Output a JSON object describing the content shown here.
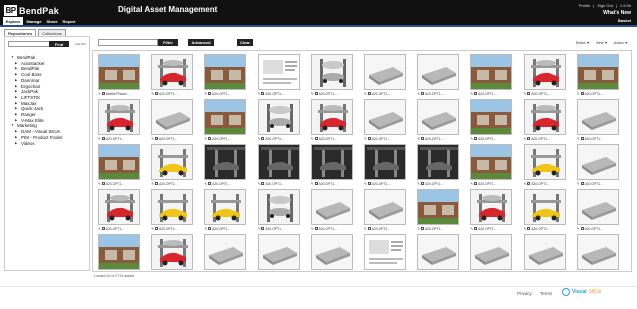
{
  "header": {
    "logo_mark": "BP",
    "logo_text": "BendPak",
    "title": "Digital Asset Management",
    "links": [
      "Profile",
      "Sign Out",
      "1.9.9h"
    ],
    "whats_new": "What's New",
    "basket": "Basket"
  },
  "nav": {
    "tabs": [
      "Explore",
      "Manage",
      "Share",
      "Report"
    ],
    "active": "Explore"
  },
  "subtabs": [
    "Repositories",
    "Collections"
  ],
  "left_panel": {
    "search_placeholder": "",
    "find_label": "Find",
    "advanced_label": "Adv.Sch"
  },
  "tree": [
    {
      "label": "BendPak",
      "level": 0,
      "arrow": "▼"
    },
    {
      "label": "Autostacker",
      "level": 1,
      "arrow": "▶"
    },
    {
      "label": "BendPak",
      "level": 1,
      "arrow": "▶"
    },
    {
      "label": "Cool Boss",
      "level": 1,
      "arrow": "▶"
    },
    {
      "label": "Dannmar",
      "level": 1,
      "arrow": "▶"
    },
    {
      "label": "Ergochair",
      "level": 1,
      "arrow": "▶"
    },
    {
      "label": "JackPak",
      "level": 1,
      "arrow": "▶"
    },
    {
      "label": "LIFTSTIK",
      "level": 1,
      "arrow": "▶"
    },
    {
      "label": "MaxJax",
      "level": 1,
      "arrow": "▶"
    },
    {
      "label": "Quick-Jack",
      "level": 1,
      "arrow": "▶"
    },
    {
      "label": "Ranger",
      "level": 1,
      "arrow": "▶"
    },
    {
      "label": "V-Max Elite",
      "level": 1,
      "arrow": "▶"
    },
    {
      "label": "Marketing",
      "level": 0,
      "arrow": "▼"
    },
    {
      "label": "DAM - Visual SKUs",
      "level": 1,
      "arrow": "▶"
    },
    {
      "label": "PIM - Product Finder",
      "level": 1,
      "arrow": "▶"
    },
    {
      "label": "Videos",
      "level": 1,
      "arrow": "▶"
    }
  ],
  "toolbar": {
    "search_placeholder": "",
    "filter": "Filter",
    "advanced": "Advanced",
    "clear": "Clear",
    "right": [
      "Select ▼",
      "View ▼",
      "Action ▼"
    ]
  },
  "assets": [
    {
      "label": "Mobile Photos...",
      "kind": "garage"
    },
    {
      "label": "A20-OPT1...",
      "kind": "lift-red"
    },
    {
      "label": "A20-OPT1...",
      "kind": "garage"
    },
    {
      "label": "A20-OPT1-...",
      "kind": "doc"
    },
    {
      "label": "A20-OPT1-...",
      "kind": "lift-gray"
    },
    {
      "label": "A20-OPT1-...",
      "kind": "platform"
    },
    {
      "label": "A20-OPT1-...",
      "kind": "platform"
    },
    {
      "label": "A20-OPT1-...",
      "kind": "garage"
    },
    {
      "label": "A20-OPT1-...",
      "kind": "lift-red"
    },
    {
      "label": "A20-OPT1-...",
      "kind": "garage"
    },
    {
      "label": "A20-OPT1...",
      "kind": "lift-red"
    },
    {
      "label": "A20-OPT1...",
      "kind": "platform"
    },
    {
      "label": "A20-OPT1...",
      "kind": "garage"
    },
    {
      "label": "A20-OPT1...",
      "kind": "lift-gray"
    },
    {
      "label": "A20-OPT1...",
      "kind": "lift-red"
    },
    {
      "label": "A20-OPT1...",
      "kind": "platform"
    },
    {
      "label": "A20-OPT1...",
      "kind": "platform"
    },
    {
      "label": "A20-OPT1...",
      "kind": "garage"
    },
    {
      "label": "A20-OPT1...",
      "kind": "lift-red"
    },
    {
      "label": "A20-OPT1...",
      "kind": "platform"
    },
    {
      "label": "A20-OPT1...",
      "kind": "garage"
    },
    {
      "label": "A20-OPT1...",
      "kind": "lift-yellow"
    },
    {
      "label": "A20-OPT1...",
      "kind": "dark"
    },
    {
      "label": "A20-OPT1...",
      "kind": "dark"
    },
    {
      "label": "A20-OPT1...",
      "kind": "dark"
    },
    {
      "label": "A20-OPT1...",
      "kind": "dark"
    },
    {
      "label": "A20-OPT1...",
      "kind": "dark"
    },
    {
      "label": "A20-OPT1...",
      "kind": "garage"
    },
    {
      "label": "A20-OPT1...",
      "kind": "lift-yellow"
    },
    {
      "label": "A20-OPT1...",
      "kind": "platform"
    },
    {
      "label": "A20-OPT1...",
      "kind": "lift-red"
    },
    {
      "label": "A20-OPT1...",
      "kind": "lift-yellow"
    },
    {
      "label": "A20-OPT1...",
      "kind": "lift-yellow"
    },
    {
      "label": "A20-OPT1...",
      "kind": "lift-gray"
    },
    {
      "label": "A20-OPT1...",
      "kind": "platform"
    },
    {
      "label": "A20-OPT1...",
      "kind": "platform"
    },
    {
      "label": "A20-OPT1...",
      "kind": "garage"
    },
    {
      "label": "A20-OPT1...",
      "kind": "lift-red"
    },
    {
      "label": "A20-OPT1...",
      "kind": "lift-yellow"
    },
    {
      "label": "A20-OPT1...",
      "kind": "platform"
    },
    {
      "label": "A20-OPT1...",
      "kind": "garage"
    },
    {
      "label": "A20-OPT1...",
      "kind": "lift-red"
    },
    {
      "label": "A20-OPT1...",
      "kind": "platform"
    },
    {
      "label": "A20-OPT1...",
      "kind": "platform"
    },
    {
      "label": "A20-OPT1...",
      "kind": "platform"
    },
    {
      "label": "A20-OPT1...",
      "kind": "doc"
    },
    {
      "label": "A20-OPT1...",
      "kind": "platform"
    },
    {
      "label": "A20-OPT1...",
      "kind": "platform"
    },
    {
      "label": "A20-OPT1...",
      "kind": "platform"
    },
    {
      "label": "A20-OPT1...",
      "kind": "platform"
    }
  ],
  "loaded_text": "Loaded 40 of 2713 assets",
  "footer": {
    "privacy": "Privacy",
    "terms": "Terms",
    "brand1": "Visual",
    "brand2": "SKUs"
  },
  "colors": {
    "topbar": "#111111",
    "accent_blue": "#2b4f8f",
    "brand_blue": "#2aa0d8",
    "brand_orange": "#f39a1e"
  }
}
